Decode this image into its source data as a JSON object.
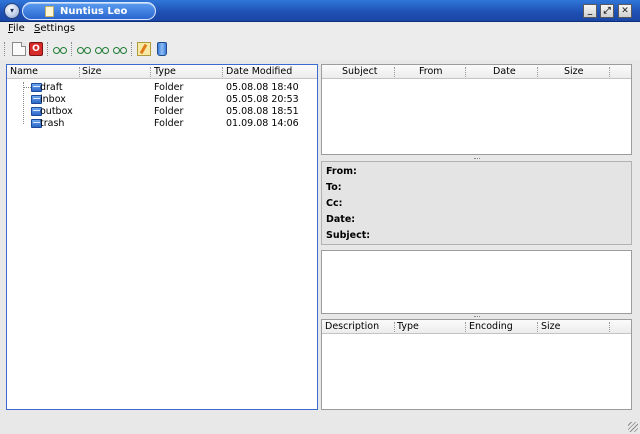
{
  "window": {
    "title": "Nuntius Leo"
  },
  "menu": {
    "file": "File",
    "file_acc": "F",
    "file_rest": "ile",
    "settings_acc": "S",
    "settings_rest": "ettings"
  },
  "toolbar": {
    "icons": [
      "new-message-icon",
      "stop-icon",
      "receive-icon",
      "find-icon",
      "forward-icon",
      "reply-icon",
      "edit-icon",
      "trash-icon"
    ]
  },
  "folders": {
    "columns": [
      "Name",
      "Size",
      "Type",
      "Date Modified"
    ],
    "rows": [
      {
        "name": "draft",
        "size": "",
        "type": "Folder",
        "date": "05.08.08 18:40"
      },
      {
        "name": "inbox",
        "size": "",
        "type": "Folder",
        "date": "05.05.08 20:53"
      },
      {
        "name": "outbox",
        "size": "",
        "type": "Folder",
        "date": "05.08.08 18:51"
      },
      {
        "name": "trash",
        "size": "",
        "type": "Folder",
        "date": "01.09.08 14:06"
      }
    ]
  },
  "messages": {
    "columns": [
      "Subject",
      "From",
      "Date",
      "Size"
    ]
  },
  "headers": {
    "from": "From:",
    "to": "To:",
    "cc": "Cc:",
    "date": "Date:",
    "subject": "Subject:"
  },
  "attachments": {
    "columns": [
      "Description",
      "Type",
      "Encoding",
      "Size"
    ]
  },
  "colors": {
    "titlebar": "#1f4fb3",
    "selection_border": "#3c6bd0",
    "folder_icon": "#2c68c9"
  }
}
